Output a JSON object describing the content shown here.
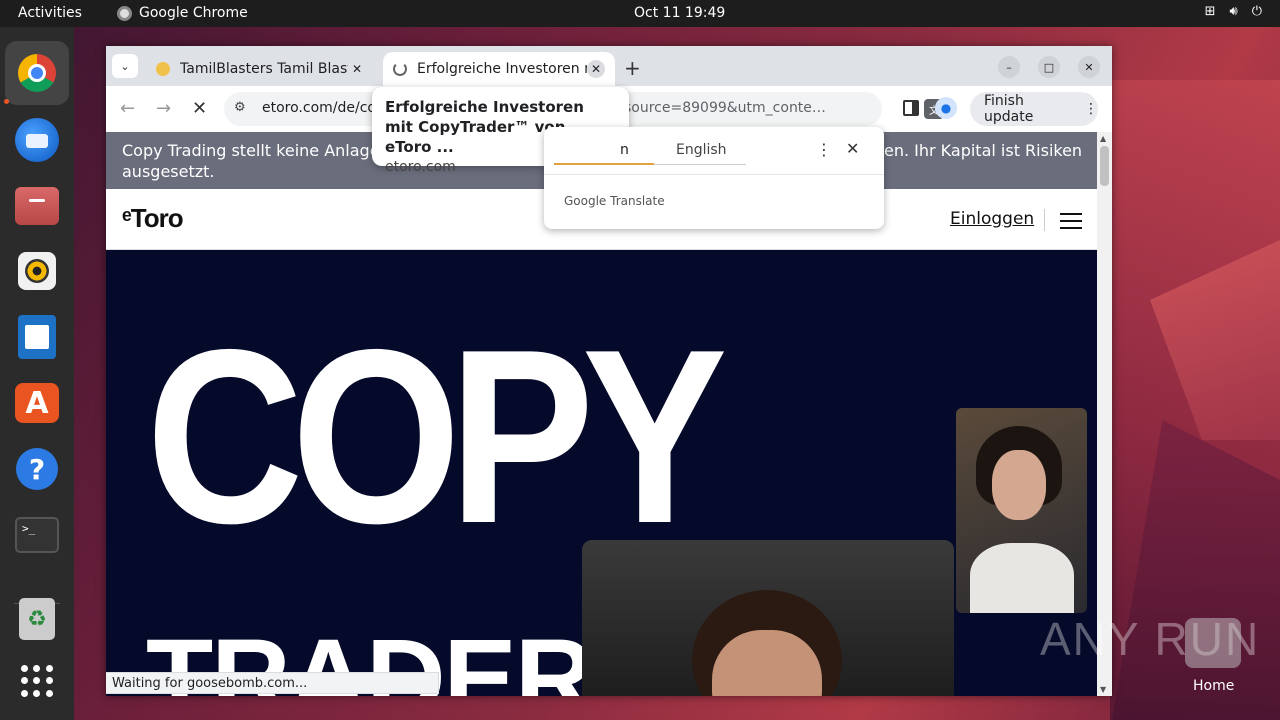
{
  "topbar": {
    "activities": "Activities",
    "app_name": "Google Chrome",
    "clock": "Oct 11  19:49"
  },
  "dock": {
    "items": [
      "chrome-icon",
      "thunderbird-icon",
      "files-icon",
      "rhythmbox-icon",
      "libreoffice-writer-icon",
      "app-store-icon",
      "help-icon",
      "terminal-icon",
      "trash-icon",
      "app-grid-icon"
    ]
  },
  "browser": {
    "tabs": [
      {
        "title": "TamilBlasters Tamil Blasters"
      },
      {
        "title": "Erfolgreiche Investoren mit CopyTrader"
      }
    ],
    "omnibox": {
      "url_host": "etoro.com/de/copytrader",
      "url_tail": "source=89099&utm_conte…"
    },
    "finish_update": "Finish update",
    "status": "Waiting for goosebomb.com..."
  },
  "tab_tooltip": {
    "title": "Erfolgreiche Investoren mit CopyTrader™ von eToro ...",
    "domain": "etoro.com"
  },
  "translate_popup": {
    "lang_source": "n",
    "lang_target": "English",
    "brand": "Google Translate"
  },
  "page": {
    "disclaimer_left": "Copy Trading stellt keine Anlageb",
    "disclaimer_left2": "ausgesetzt.",
    "disclaimer_right": "en. Ihr Kapital ist Risiken",
    "logo": "ᵉToro",
    "login": "Einloggen",
    "hero_line1": "COPY",
    "hero_line2": "TRADER"
  },
  "desktop": {
    "watermark": "ANY RUN",
    "home_label": "Home"
  }
}
